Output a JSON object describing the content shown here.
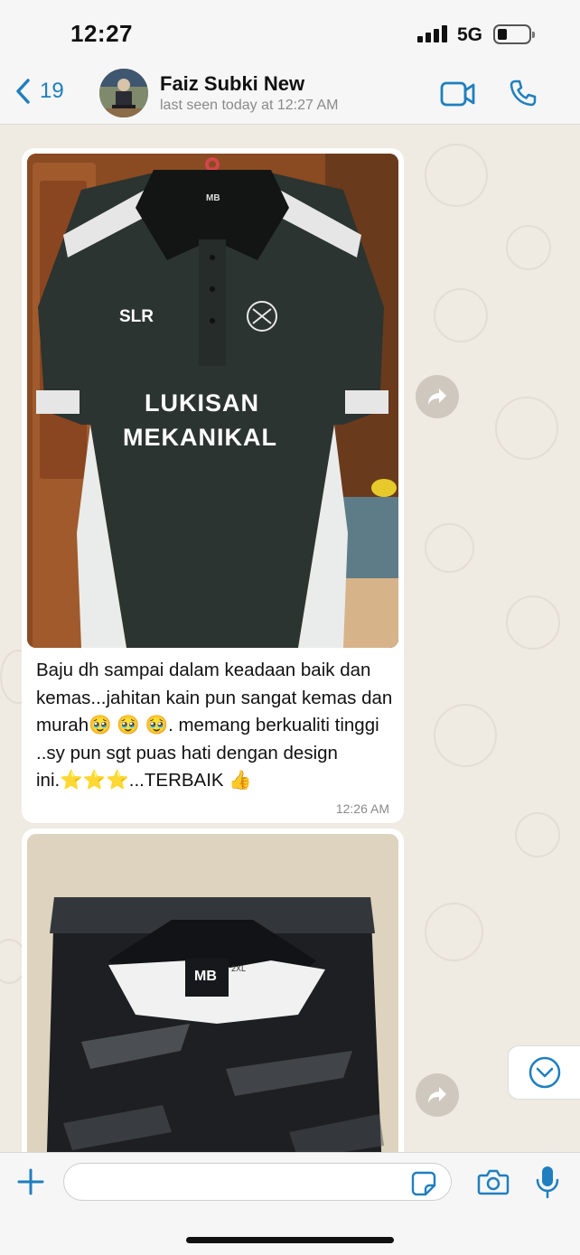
{
  "status_bar": {
    "time": "12:27",
    "network": "5G"
  },
  "header": {
    "back_count": "19",
    "contact_name": "Faiz Subki New",
    "last_seen": "last seen today at 12:27 AM"
  },
  "messages": [
    {
      "type": "image_caption",
      "image_texts": {
        "brand": "SLR",
        "line1": "LUKISAN",
        "line2": "MEKANIKAL",
        "hanger_tag": "MB"
      },
      "caption": "Baju dh sampai dalam keadaan baik dan kemas...jahitan kain pun sangat kemas dan murah🥹 🥹 🥹. memang berkualiti tinggi ..sy pun sgt puas hati dengan design ini.⭐⭐⭐...TERBAIK 👍",
      "time": "12:26 AM"
    },
    {
      "type": "image",
      "image_texts": {
        "label_brand": "MB",
        "label_size": "2XL"
      }
    }
  ],
  "composer": {
    "placeholder": ""
  },
  "icons": {
    "back": "chevron-left-icon",
    "video": "video-call-icon",
    "phone": "phone-icon",
    "forward": "forward-icon",
    "scroll_down": "chevron-down-icon",
    "add": "plus-icon",
    "sticker": "sticker-icon",
    "camera": "camera-icon",
    "mic": "microphone-icon"
  },
  "colors": {
    "accent": "#1f7fbf",
    "chat_bg": "#efeae2",
    "bubble": "#ffffff"
  }
}
